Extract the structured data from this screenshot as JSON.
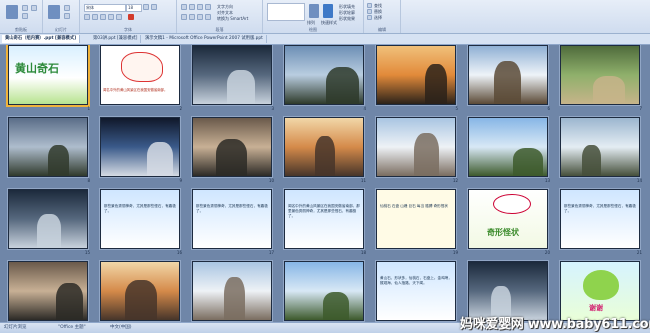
{
  "ribbon": {
    "groups": [
      {
        "label": "剪贴板"
      },
      {
        "label": "幻灯片"
      },
      {
        "label": "字体"
      },
      {
        "label": "段落"
      },
      {
        "label": "绘图"
      },
      {
        "label": "编辑"
      }
    ],
    "font_name": "宋体",
    "font_size": "18",
    "controls": [
      "文字方向",
      "对齐文本",
      "转换为 SmartArt",
      "排列",
      "快速样式",
      "形状填充",
      "形状轮廓",
      "形状效果",
      "查找",
      "替换",
      "选择"
    ]
  },
  "tabs": [
    {
      "label": "黄山奇石（组内赛）.ppt [兼容模式]",
      "active": true
    },
    {
      "label": "第03讲.ppt [兼容模式]",
      "active": false
    },
    {
      "label": "演示文稿1 - Microsoft Office PowerPoint 2007 试用版.ppt",
      "active": false
    }
  ],
  "slides": [
    {
      "n": "1",
      "kind": "title",
      "text": "黄山奇石"
    },
    {
      "n": "2",
      "kind": "map",
      "text": "闻名中外的黄山风景区在我国安徽省南部。"
    },
    {
      "n": "3",
      "kind": "photo"
    },
    {
      "n": "4",
      "kind": "photo"
    },
    {
      "n": "5",
      "kind": "photo"
    },
    {
      "n": "6",
      "kind": "photo"
    },
    {
      "n": "7",
      "kind": "photo"
    },
    {
      "n": "8",
      "kind": "photo"
    },
    {
      "n": "9",
      "kind": "photo"
    },
    {
      "n": "10",
      "kind": "photo"
    },
    {
      "n": "11",
      "kind": "photo"
    },
    {
      "n": "12",
      "kind": "photo"
    },
    {
      "n": "13",
      "kind": "photo"
    },
    {
      "n": "14",
      "kind": "photo"
    },
    {
      "n": "15",
      "kind": "photo"
    },
    {
      "n": "16",
      "kind": "text",
      "text": "那些景色秀丽神奇，尤其是那些怪石，有趣极了。"
    },
    {
      "n": "17",
      "kind": "text",
      "text": "那些景色秀丽神奇，尤其是那些怪石，有趣极了。"
    },
    {
      "n": "18",
      "kind": "text",
      "text": "闻名中外的黄山风景区在我国安徽省南部。那里景色秀丽神奇，尤其是那些怪石，有趣极了。"
    },
    {
      "n": "19",
      "kind": "words",
      "text": "仙桃石  石盘  山峰  巨石  每当  胳膊  奇形怪状"
    },
    {
      "n": "20",
      "kind": "cartoon",
      "text": "奇形怪状"
    },
    {
      "n": "21",
      "kind": "text",
      "text": "那些景色秀丽神奇，尤其是那些怪石，有趣极了。"
    },
    {
      "n": "22",
      "kind": "photo"
    },
    {
      "n": "23",
      "kind": "photo"
    },
    {
      "n": "24",
      "kind": "photo"
    },
    {
      "n": "25",
      "kind": "photo"
    },
    {
      "n": "26",
      "kind": "text",
      "text": "黄山石，形状多，仙桃石，石盘上。金鸡啼，猴观海，仙人指路，天下闻。"
    },
    {
      "n": "27",
      "kind": "photo"
    },
    {
      "n": "28",
      "kind": "end",
      "text": "谢谢"
    }
  ],
  "status": {
    "left": "幻灯片浏览",
    "theme": "\"Office 主题\"",
    "lang": "中文(中国)"
  },
  "watermark": "妈咪爱婴网 www.baby611.com"
}
